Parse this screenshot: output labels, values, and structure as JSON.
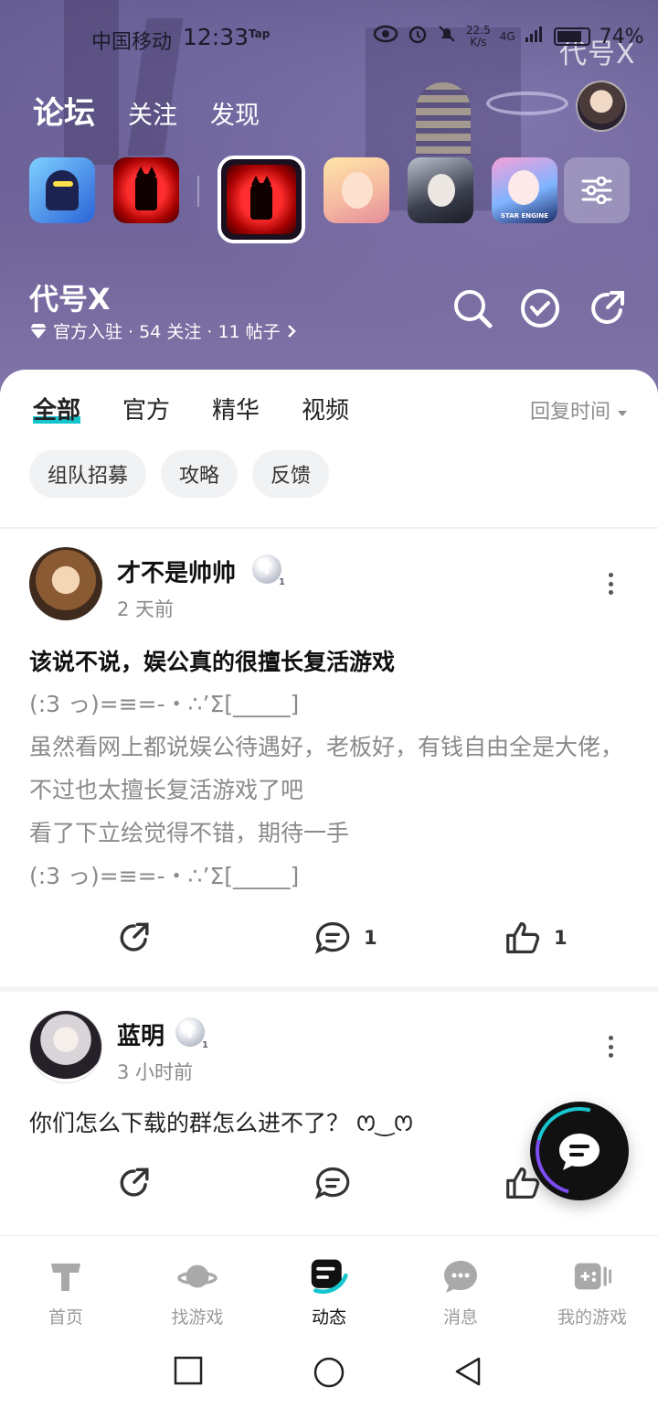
{
  "status_bar": {
    "carrier": "中国移动",
    "time": "12:33",
    "tap_label": "Tap",
    "net_speed": "22.5\nK/s",
    "net_type": "4G",
    "battery": "74%"
  },
  "watermark": "代号X",
  "top_nav": {
    "tabs": [
      {
        "label": "论坛",
        "active": true
      },
      {
        "label": "关注",
        "active": false
      },
      {
        "label": "发现",
        "active": false
      }
    ]
  },
  "game_strip": {
    "star_engine_label": "STAR ENGINE"
  },
  "forum": {
    "title": "代号X",
    "meta": "官方入驻 · 54 关注 · 11 帖子"
  },
  "content_tabs": {
    "tabs": [
      "全部",
      "官方",
      "精华",
      "视频"
    ],
    "active": "全部",
    "sort_label": "回复时间"
  },
  "chips": [
    "组队招募",
    "攻略",
    "反馈"
  ],
  "posts": [
    {
      "author": "才不是帅帅",
      "badge": "T",
      "badge_level": "1",
      "time": "2 天前",
      "title": "该说不说，娱公真的很擅长复活游戏",
      "body_lines": [
        "(:3 っ)=≡=-・∴’Σ[_____]",
        "虽然看网上都说娱公待遇好，老板好，有钱自由全是大佬，不过也太擅长复活游戏了吧",
        "看了下立绘觉得不错，期待一手",
        "(:3 っ)=≡=-・∴’Σ[_____]"
      ],
      "comments": "1",
      "likes": "1"
    },
    {
      "author": "蓝明",
      "badge": "T",
      "badge_level": "1",
      "time": "3 小时前",
      "body": "你们怎么下载的群怎么进不了？ ꯁ‿ꯁ",
      "comments": "",
      "likes": ""
    }
  ],
  "bottom_nav": {
    "items": [
      {
        "label": "首页",
        "icon": "tap-home-icon",
        "active": false
      },
      {
        "label": "找游戏",
        "icon": "planet-icon",
        "active": false
      },
      {
        "label": "动态",
        "icon": "feed-icon",
        "active": true
      },
      {
        "label": "消息",
        "icon": "message-icon",
        "active": false
      },
      {
        "label": "我的游戏",
        "icon": "gamepad-icon",
        "active": false
      }
    ]
  },
  "colors": {
    "accent": "#15c5ce",
    "banner": "#6a5f93",
    "muted_text": "#8a8a8a"
  }
}
